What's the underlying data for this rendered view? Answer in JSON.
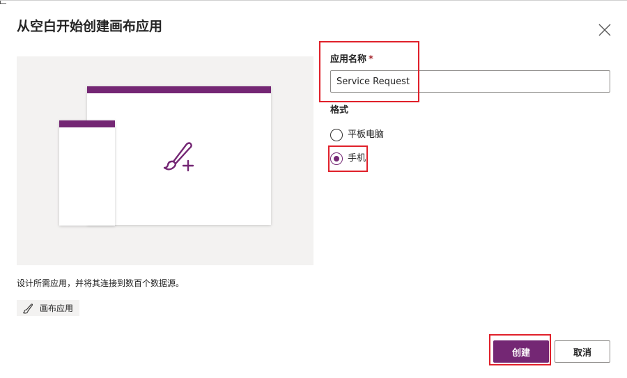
{
  "dialog": {
    "title": "从空白开始创建画布应用"
  },
  "preview": {
    "description": "设计所需应用，并将其连接到数百个数据源。",
    "tag_label": "画布应用",
    "accent_color": "#742774"
  },
  "form": {
    "app_name_label": "应用名称",
    "required_marker": "*",
    "app_name_value": "Service Request",
    "format_label": "格式",
    "format_options": [
      {
        "label": "平板电脑",
        "selected": false
      },
      {
        "label": "手机",
        "selected": true
      }
    ]
  },
  "buttons": {
    "create_label": "创建",
    "cancel_label": "取消"
  },
  "icons": {
    "close": "close-icon",
    "brush_plus": "brush-plus-icon",
    "brush": "brush-icon"
  },
  "colors": {
    "brand": "#742774",
    "highlight": "#e0202a",
    "preview_bg": "#f3f2f1"
  }
}
